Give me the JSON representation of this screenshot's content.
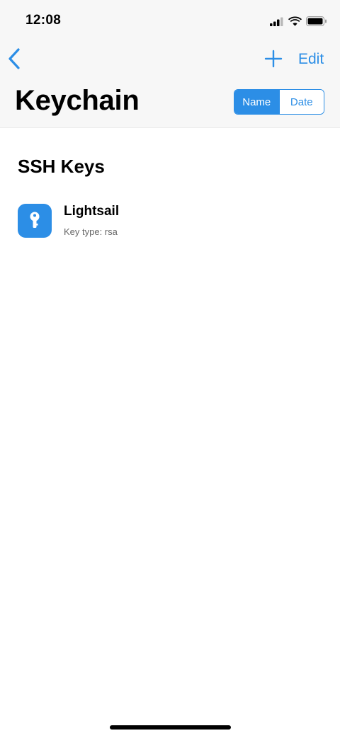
{
  "status_bar": {
    "time": "12:08"
  },
  "nav": {
    "edit_label": "Edit"
  },
  "header": {
    "title": "Keychain"
  },
  "sort": {
    "options": [
      "Name",
      "Date"
    ],
    "selected": "Name"
  },
  "section": {
    "title": "SSH Keys"
  },
  "keys": [
    {
      "name": "Lightsail",
      "subtitle": "Key type: rsa",
      "icon": "key-icon"
    }
  ],
  "colors": {
    "accent": "#2c8ee6",
    "header_bg": "#f7f7f7"
  }
}
